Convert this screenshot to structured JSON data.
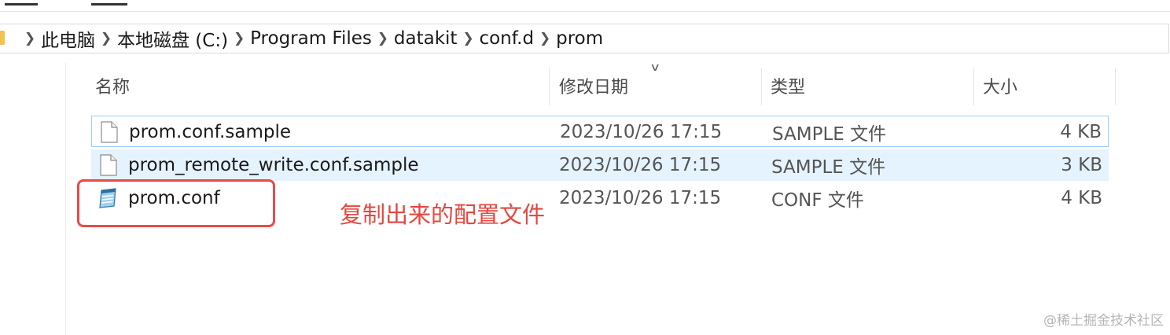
{
  "breadcrumb": [
    "此电脑",
    "本地磁盘 (C:)",
    "Program Files",
    "datakit",
    "conf.d",
    "prom"
  ],
  "columns": {
    "name": "名称",
    "date": "修改日期",
    "type": "类型",
    "size": "大小"
  },
  "files": [
    {
      "name": "prom.conf.sample",
      "date": "2023/10/26 17:15",
      "type": "SAMPLE 文件",
      "size": "4 KB",
      "icon": "blank-file-icon",
      "state": "focused"
    },
    {
      "name": "prom_remote_write.conf.sample",
      "date": "2023/10/26 17:15",
      "type": "SAMPLE 文件",
      "size": "3 KB",
      "icon": "blank-file-icon",
      "state": "hover"
    },
    {
      "name": "prom.conf",
      "date": "2023/10/26 17:15",
      "type": "CONF 文件",
      "size": "4 KB",
      "icon": "notepad-file-icon",
      "state": "normal"
    }
  ],
  "annotation": {
    "text": "复制出来的配置文件",
    "color": "#e5473f"
  },
  "watermark": "@稀土掘金技术社区",
  "colors": {
    "selection_border": "#99d1ff",
    "hover_background": "#e5f3ff",
    "annotation_box": "#e84a4a"
  }
}
